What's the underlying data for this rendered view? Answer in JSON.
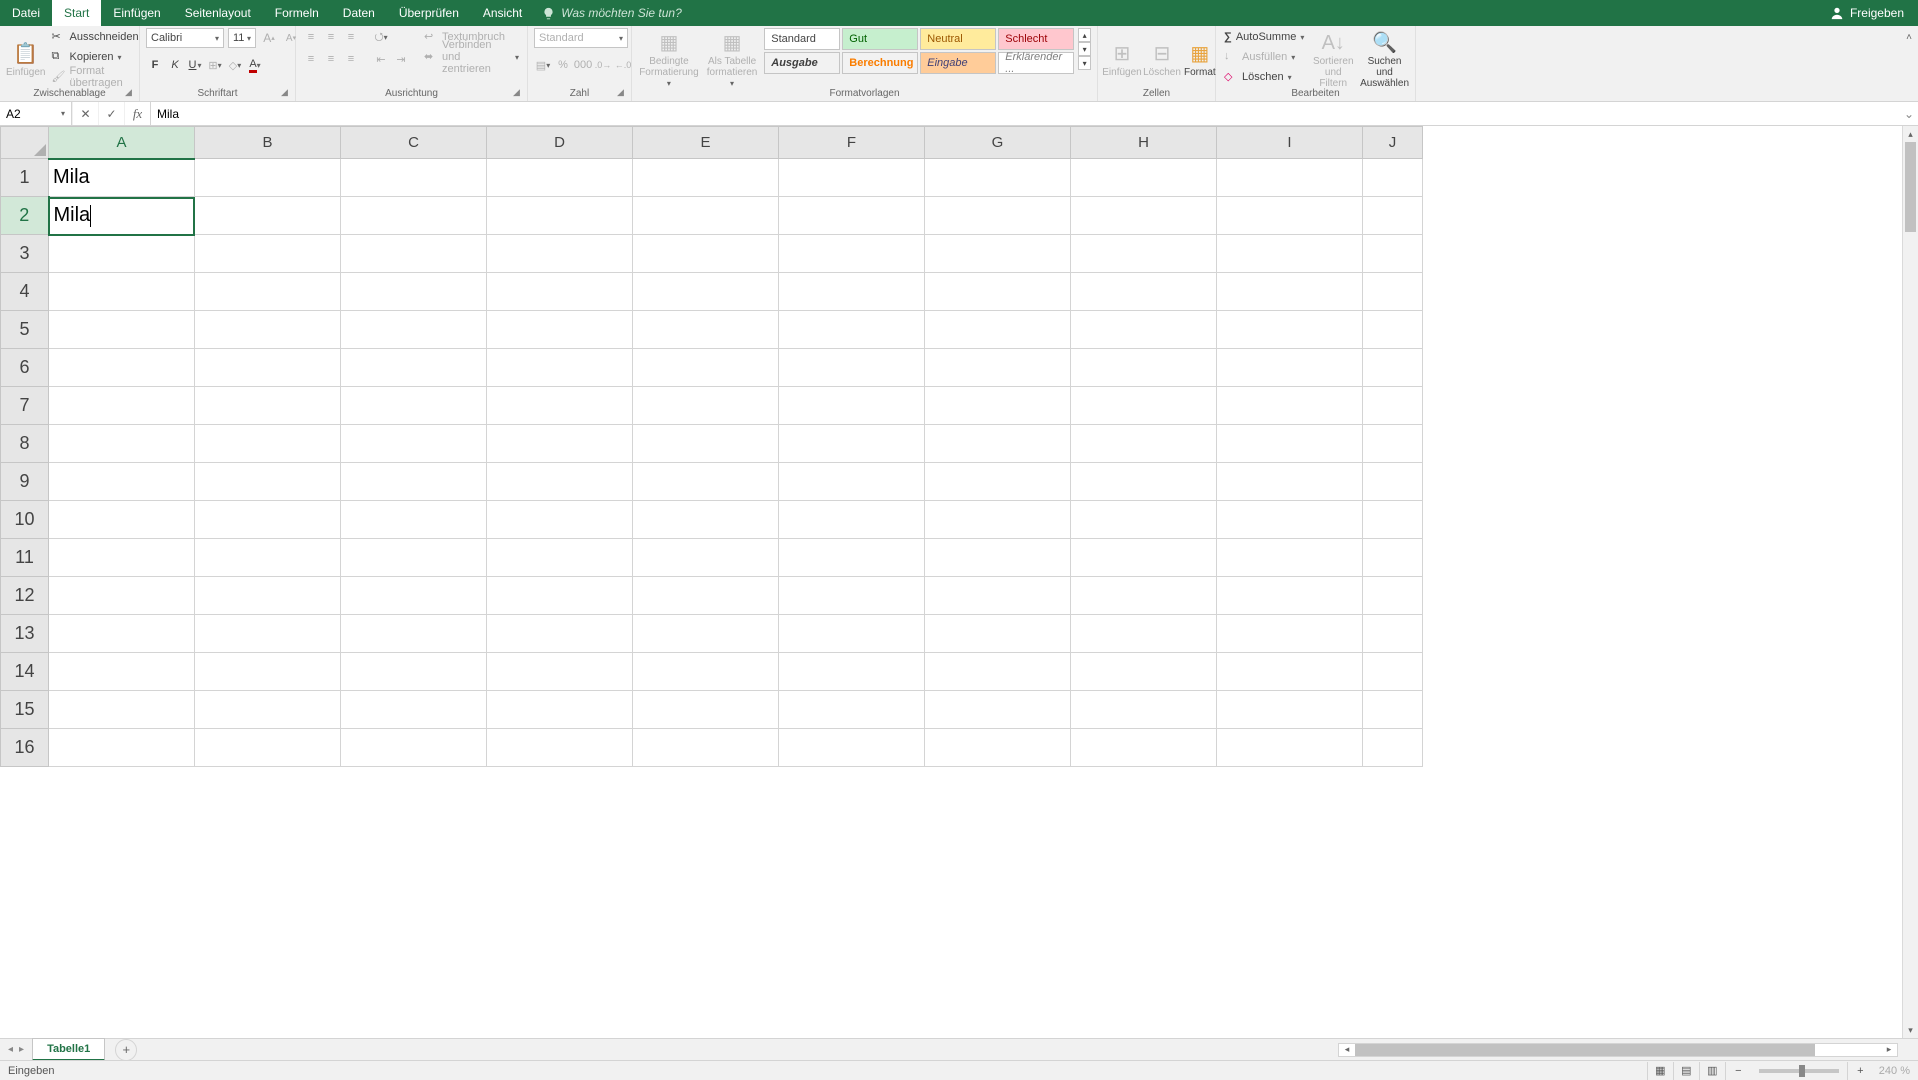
{
  "tabs": {
    "file": "Datei",
    "start": "Start",
    "insert": "Einfügen",
    "pagelayout": "Seitenlayout",
    "formulas": "Formeln",
    "data": "Daten",
    "review": "Überprüfen",
    "view": "Ansicht",
    "tellme_placeholder": "Was möchten Sie tun?",
    "share": "Freigeben"
  },
  "ribbon": {
    "clipboard": {
      "paste": "Einfügen",
      "cut": "Ausschneiden",
      "copy": "Kopieren",
      "painter": "Format übertragen",
      "label": "Zwischenablage"
    },
    "font": {
      "name": "Calibri",
      "size": "11",
      "label": "Schriftart"
    },
    "alignment": {
      "wrap": "Textumbruch",
      "merge": "Verbinden und zentrieren",
      "label": "Ausrichtung"
    },
    "number": {
      "format_name": "Standard",
      "label": "Zahl"
    },
    "styles": {
      "cond": "Bedingte Formatierung",
      "table": "Als Tabelle formatieren",
      "s_standard": "Standard",
      "s_gut": "Gut",
      "s_neutral": "Neutral",
      "s_schlecht": "Schlecht",
      "s_ausgabe": "Ausgabe",
      "s_berechnung": "Berechnung",
      "s_eingabe": "Eingabe",
      "s_erklarender": "Erklärender ...",
      "label": "Formatvorlagen"
    },
    "cells": {
      "insert": "Einfügen",
      "delete": "Löschen",
      "format": "Format",
      "label": "Zellen"
    },
    "editing": {
      "autosum": "AutoSumme",
      "fill": "Ausfüllen",
      "clear": "Löschen",
      "sort": "Sortieren und Filtern",
      "find": "Suchen und Auswählen",
      "label": "Bearbeiten"
    }
  },
  "formula_bar": {
    "name_box": "A2",
    "formula": "Mila"
  },
  "grid": {
    "columns": [
      "A",
      "B",
      "C",
      "D",
      "E",
      "F",
      "G",
      "H",
      "I",
      "J"
    ],
    "rows": [
      "1",
      "2",
      "3",
      "4",
      "5",
      "6",
      "7",
      "8",
      "9",
      "10",
      "11",
      "12",
      "13",
      "14",
      "15",
      "16"
    ],
    "cells": {
      "A1": "Mila",
      "A2": "Mila"
    },
    "active_col": "A",
    "active_row": "2"
  },
  "sheet": {
    "tab1": "Tabelle1"
  },
  "status": {
    "mode": "Eingeben",
    "zoom": "240 %"
  },
  "style_colors": {
    "gut_bg": "#c6efce",
    "gut_fg": "#006100",
    "neutral_bg": "#ffeb9c",
    "neutral_fg": "#9c5700",
    "schlecht_bg": "#ffc7ce",
    "schlecht_fg": "#9c0006",
    "ausgabe_bg": "#f2f2f2",
    "ausgabe_fg": "#3f3f3f",
    "berechnung_bg": "#f2f2f2",
    "berechnung_fg": "#fa7d00",
    "eingabe_bg": "#ffcc99",
    "eingabe_fg": "#3f3f76"
  }
}
